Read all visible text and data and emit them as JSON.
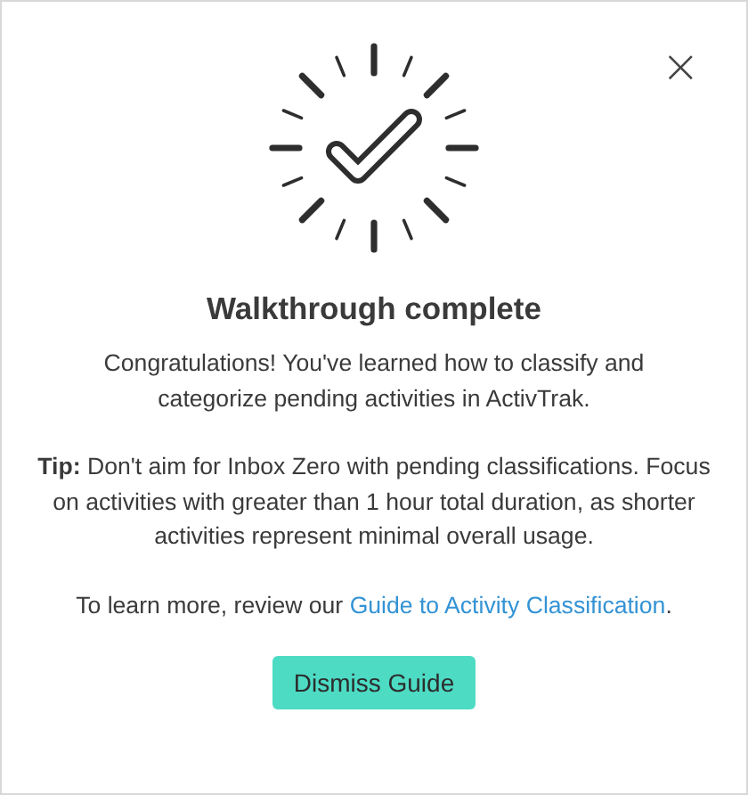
{
  "dialog": {
    "close_icon": "×",
    "title": "Walkthrough complete",
    "message": "Congratulations! You've learned how to classify and categorize pending activities in ActivTrak.",
    "tip": "**Tip:** Don't aim for Inbox Zero with pending classifications. Focus on activities with greater than 1 hour total duration, as shorter activities represent minimal overall usage.",
    "learn_more": {
      "prefix": "To learn more, review our ",
      "link": "Guide to Activity Classification",
      "suffix": "."
    },
    "button": "Dismiss Guide"
  }
}
